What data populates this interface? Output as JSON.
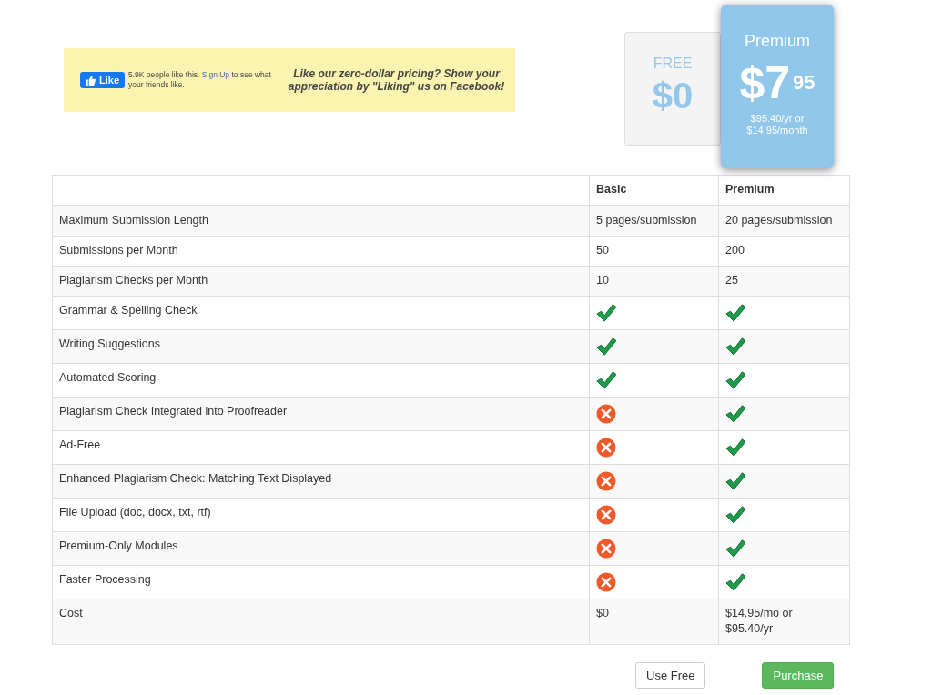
{
  "facebook_banner": {
    "like_button": "Like",
    "like_count": "5.9K people like this.",
    "signup_link": "Sign Up",
    "signup_text": "to see what your friends like.",
    "message": "Like our zero-dollar pricing? Show your appreciation by \"Liking\" us on Facebook!"
  },
  "plans": [
    {
      "kind": "free",
      "name": "FREE",
      "price": "$0"
    },
    {
      "kind": "premium",
      "name": "Premium",
      "price": "$7",
      "cents": "95",
      "note": "$95.40/yr or $14.95/month"
    }
  ],
  "table": {
    "columns": [
      "",
      "Basic",
      "Premium"
    ],
    "rows": [
      {
        "cells": [
          {
            "kind": "feature",
            "text": "Maximum Submission Length"
          },
          {
            "kind": "text",
            "text": "5 pages/submission"
          },
          {
            "kind": "text",
            "text": "20 pages/submission"
          }
        ]
      },
      {
        "cells": [
          {
            "kind": "feature",
            "text": "Submissions per Month"
          },
          {
            "kind": "text",
            "text": "50"
          },
          {
            "kind": "text",
            "text": "200"
          }
        ]
      },
      {
        "cells": [
          {
            "kind": "feature",
            "text": "Plagiarism Checks per Month"
          },
          {
            "kind": "text",
            "text": "10"
          },
          {
            "kind": "text",
            "text": "25"
          }
        ]
      },
      {
        "cells": [
          {
            "kind": "feature",
            "text": "Grammar & Spelling Check"
          },
          {
            "kind": "check"
          },
          {
            "kind": "check"
          }
        ]
      },
      {
        "cells": [
          {
            "kind": "feature",
            "text": "Writing Suggestions"
          },
          {
            "kind": "check"
          },
          {
            "kind": "check"
          }
        ]
      },
      {
        "cells": [
          {
            "kind": "feature",
            "text": "Automated Scoring"
          },
          {
            "kind": "check"
          },
          {
            "kind": "check"
          }
        ]
      },
      {
        "cells": [
          {
            "kind": "feature",
            "text": "Plagiarism Check Integrated into Proofreader"
          },
          {
            "kind": "cross"
          },
          {
            "kind": "check"
          }
        ]
      },
      {
        "cells": [
          {
            "kind": "feature",
            "text": "Ad-Free"
          },
          {
            "kind": "cross"
          },
          {
            "kind": "check"
          }
        ]
      },
      {
        "cells": [
          {
            "kind": "feature",
            "text": "Enhanced Plagiarism Check: Matching Text Displayed"
          },
          {
            "kind": "cross"
          },
          {
            "kind": "check"
          }
        ]
      },
      {
        "cells": [
          {
            "kind": "feature",
            "text": "File Upload (doc, docx, txt, rtf)"
          },
          {
            "kind": "cross"
          },
          {
            "kind": "check"
          }
        ]
      },
      {
        "cells": [
          {
            "kind": "feature",
            "text": "Premium-Only Modules"
          },
          {
            "kind": "cross"
          },
          {
            "kind": "check"
          }
        ]
      },
      {
        "cells": [
          {
            "kind": "feature",
            "text": "Faster Processing"
          },
          {
            "kind": "cross"
          },
          {
            "kind": "check"
          }
        ]
      },
      {
        "cells": [
          {
            "kind": "feature",
            "text": "Cost"
          },
          {
            "kind": "text",
            "text": "$0"
          },
          {
            "kind": "text",
            "text": "$14.95/mo or $95.40/yr"
          }
        ]
      }
    ]
  },
  "buttons": [
    {
      "kind": "default",
      "label": "Use Free"
    },
    {
      "kind": "primary",
      "label": "Purchase"
    }
  ]
}
